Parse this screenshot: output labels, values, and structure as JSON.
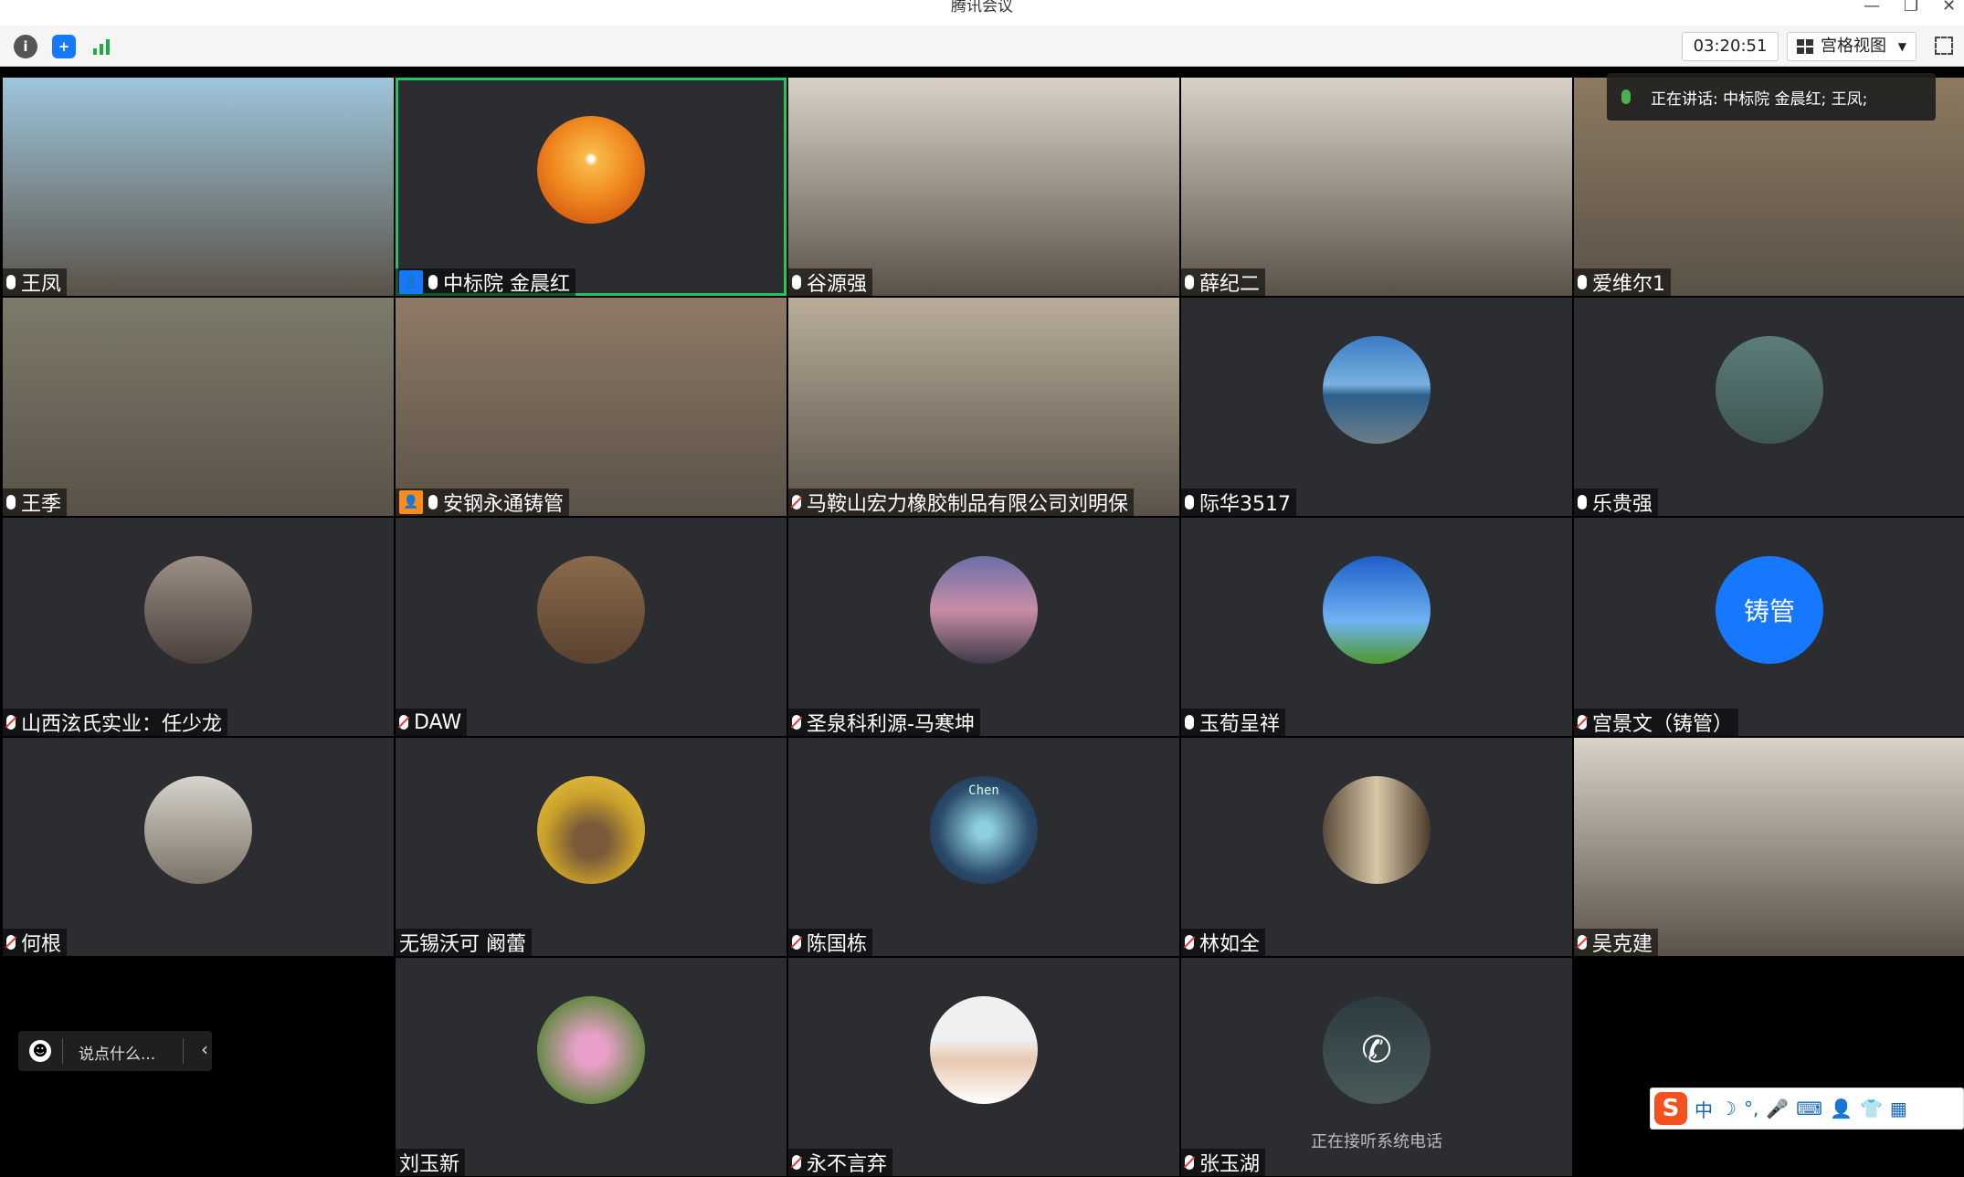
{
  "window": {
    "title": "腾讯会议"
  },
  "toolbar": {
    "timer": "03:20:51",
    "view_label": "宫格视图"
  },
  "speaking": "正在讲话: 中标院 金晨红; 王凤;",
  "chat": {
    "placeholder": "说点什么..."
  },
  "participants": [
    {
      "name": "王凤",
      "mic": "on",
      "kind": "video",
      "bg": "#9ec6dc"
    },
    {
      "name": "中标院 金晨红",
      "mic": "on",
      "kind": "avatar",
      "avatar": "sunset-tree",
      "host": true,
      "host_color": "#1677ff",
      "active": true
    },
    {
      "name": "谷源强",
      "mic": "on",
      "kind": "video",
      "bg": "#d9d2c7"
    },
    {
      "name": "薛纪二",
      "mic": "on",
      "kind": "video",
      "bg": "#d9d2c7"
    },
    {
      "name": "爱维尔1",
      "mic": "on",
      "kind": "video",
      "bg": "#8c7a60"
    },
    {
      "name": "王季",
      "mic": "on",
      "kind": "video",
      "bg": "#7d7a6a"
    },
    {
      "name": "安钢永通铸管",
      "mic": "on",
      "kind": "video",
      "bg": "#8f7a66",
      "host": true,
      "host_color": "#ff8c1a"
    },
    {
      "name": "马鞍山宏力橡胶制品有限公司刘明保",
      "mic": "muted",
      "kind": "video",
      "bg": "#b9ad9a"
    },
    {
      "name": "际华3517",
      "mic": "on",
      "kind": "avatar",
      "avatar": "sea"
    },
    {
      "name": "乐贵强",
      "mic": "on",
      "kind": "avatar",
      "avatar": "rock"
    },
    {
      "name": "山西泫氏实业：任少龙",
      "mic": "muted",
      "kind": "avatar",
      "avatar": "couple"
    },
    {
      "name": "DAW",
      "mic": "muted",
      "kind": "avatar",
      "avatar": "kids"
    },
    {
      "name": "圣泉科利源-马寒坤",
      "mic": "muted",
      "kind": "avatar",
      "avatar": "car"
    },
    {
      "name": "玉荀呈祥",
      "mic": "on",
      "kind": "avatar",
      "avatar": "sky"
    },
    {
      "name": "宫景文（铸管）",
      "mic": "muted",
      "kind": "avatar",
      "avatar_text": "铸管"
    },
    {
      "name": "何根",
      "mic": "muted",
      "kind": "avatar",
      "avatar": "window"
    },
    {
      "name": "无锡沃可 阚蕾",
      "mic": "none",
      "kind": "avatar",
      "avatar": "cat"
    },
    {
      "name": "陈国栋",
      "mic": "muted",
      "kind": "avatar",
      "avatar": "chen",
      "avatar_label": "Chen"
    },
    {
      "name": "林如全",
      "mic": "muted",
      "kind": "avatar",
      "avatar": "alley"
    },
    {
      "name": "吴克建",
      "mic": "muted",
      "kind": "video",
      "bg": "#d9d2c7"
    },
    {
      "name": "",
      "kind": "empty"
    },
    {
      "name": "刘玉新",
      "mic": "none",
      "kind": "avatar",
      "avatar": "flowers"
    },
    {
      "name": "永不言弃",
      "mic": "muted",
      "kind": "avatar",
      "avatar": "man"
    },
    {
      "name": "张玉湖",
      "mic": "muted",
      "kind": "avatar",
      "avatar": "phone",
      "status": "正在接听系统电话"
    },
    {
      "name": "",
      "kind": "empty"
    }
  ],
  "icons": {
    "info": "info-icon",
    "shield": "shield-icon",
    "signal": "signal-icon",
    "grid": "grid-view-icon",
    "fullscreen": "fullscreen-icon",
    "mic": "mic-icon",
    "emoji": "emoji-icon",
    "chevron": "chevron-left-icon"
  },
  "ime": {
    "items": [
      "中",
      "☽",
      "°,",
      "🎤",
      "⌨",
      "👤",
      "👕",
      "▦"
    ]
  }
}
